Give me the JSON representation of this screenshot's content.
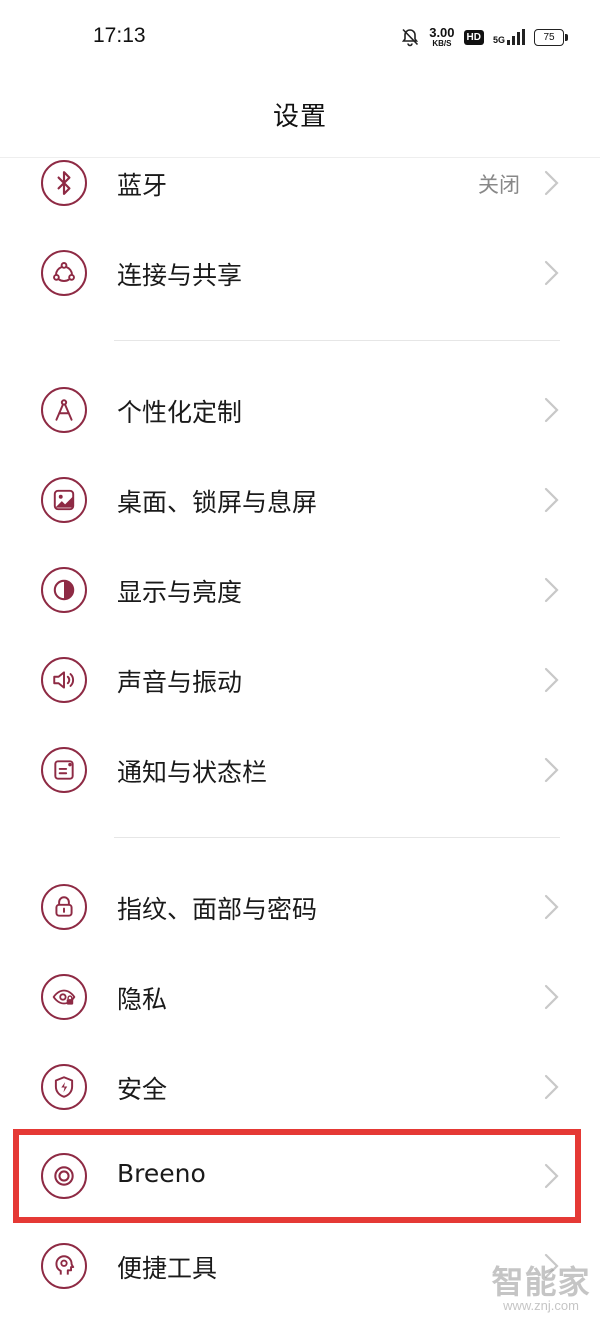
{
  "status_bar": {
    "time": "17:13",
    "net_speed_value": "3.00",
    "net_speed_unit": "KB/S",
    "hd_label": "HD",
    "network_type": "5G",
    "battery": "75"
  },
  "page": {
    "title": "设置"
  },
  "colors": {
    "icon_accent": "#8e2a44",
    "highlight": "#e53935",
    "secondary_text": "#888888"
  },
  "settings": {
    "bluetooth": {
      "label": "蓝牙",
      "value": "关闭",
      "icon": "bluetooth-icon"
    },
    "connection_sharing": {
      "label": "连接与共享",
      "icon": "connection-share-icon"
    },
    "personalization": {
      "label": "个性化定制",
      "icon": "compass-icon"
    },
    "desktop_lockscreen": {
      "label": "桌面、锁屏与息屏",
      "icon": "wallpaper-icon"
    },
    "display_brightness": {
      "label": "显示与亮度",
      "icon": "brightness-icon"
    },
    "sound_vibration": {
      "label": "声音与振动",
      "icon": "speaker-icon"
    },
    "notification_statusbar": {
      "label": "通知与状态栏",
      "icon": "notification-icon"
    },
    "fingerprint_face_password": {
      "label": "指纹、面部与密码",
      "icon": "lock-icon"
    },
    "privacy": {
      "label": "隐私",
      "icon": "privacy-eye-icon"
    },
    "security": {
      "label": "安全",
      "icon": "shield-icon"
    },
    "breeno": {
      "label": "Breeno",
      "icon": "breeno-icon"
    },
    "shortcut_tools": {
      "label": "便捷工具",
      "icon": "tools-head-icon"
    }
  },
  "watermark": {
    "logo": "智能家",
    "url": "www.znj.com"
  }
}
